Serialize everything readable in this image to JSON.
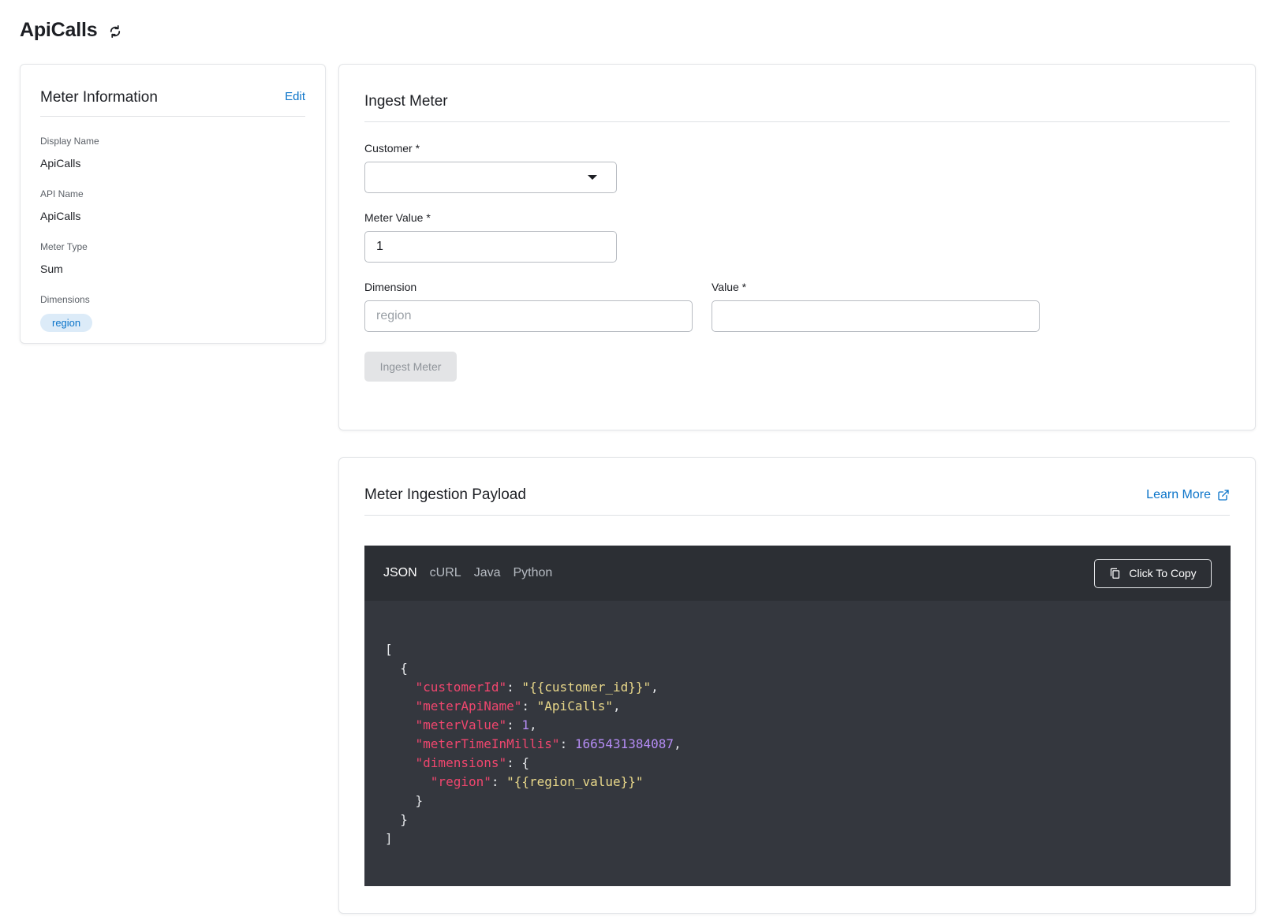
{
  "header": {
    "title": "ApiCalls",
    "refresh_icon": "refresh-icon"
  },
  "meter_info": {
    "title": "Meter Information",
    "edit_label": "Edit",
    "fields": [
      {
        "label": "Display Name",
        "value": "ApiCalls"
      },
      {
        "label": "API Name",
        "value": "ApiCalls"
      },
      {
        "label": "Meter Type",
        "value": "Sum"
      }
    ],
    "dimensions_label": "Dimensions",
    "dimensions": [
      "region"
    ]
  },
  "ingest": {
    "title": "Ingest Meter",
    "customer_label": "Customer *",
    "customer_value": "",
    "meter_value_label": "Meter Value *",
    "meter_value": "1",
    "dimension_label": "Dimension",
    "dimension_placeholder": "region",
    "value_label": "Value *",
    "value_value": "",
    "submit_label": "Ingest Meter"
  },
  "payload": {
    "title": "Meter Ingestion Payload",
    "learn_more": "Learn More",
    "tabs": [
      "JSON",
      "cURL",
      "Java",
      "Python"
    ],
    "active_tab": "JSON",
    "copy_label": "Click To Copy",
    "code": {
      "customerId_key": "\"customerId\"",
      "customerId_val": "\"{{customer_id}}\"",
      "meterApiName_key": "\"meterApiName\"",
      "meterApiName_val": "\"ApiCalls\"",
      "meterValue_key": "\"meterValue\"",
      "meterValue_val": "1",
      "meterTime_key": "\"meterTimeInMillis\"",
      "meterTime_val": "1665431384087",
      "dimensions_key": "\"dimensions\"",
      "region_key": "\"region\"",
      "region_val": "\"{{region_value}}\""
    }
  },
  "colors": {
    "link": "#0b74c9",
    "code_bg": "#34373e",
    "code_key": "#f0466e",
    "code_string": "#e9d88a",
    "code_number": "#b58cf5"
  }
}
